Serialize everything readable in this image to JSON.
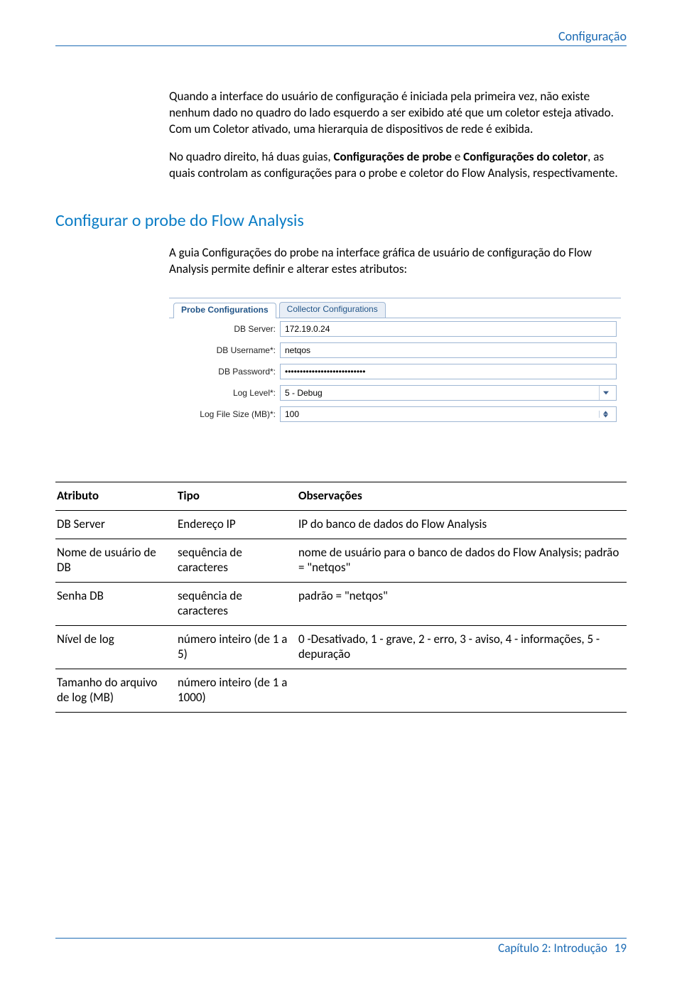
{
  "header": {
    "title": "Configuração"
  },
  "body": {
    "p1_a": "Quando a interface do usuário de configuração é iniciada pela primeira vez, não existe nenhum dado no quadro do lado esquerdo a ser exibido até que um coletor esteja ativado. Com um Coletor ativado, uma hierarquia de dispositivos de rede é exibida.",
    "p2_prefix": "No quadro direito, há duas guias, ",
    "p2_bold1": "Configurações de probe",
    "p2_middle": " e ",
    "p2_bold2": "Configurações do coletor",
    "p2_suffix": ", as quais controlam as configurações para o probe e coletor do Flow Analysis, respectivamente."
  },
  "section": {
    "title": "Configurar o probe do Flow Analysis",
    "intro": "A guia Configurações do probe na interface gráfica de usuário de configuração do Flow Analysis permite definir e alterar estes atributos:"
  },
  "shot": {
    "tab_probe": "Probe Configurations",
    "tab_collector": "Collector Configurations",
    "labels": {
      "db_server": "DB Server:",
      "db_user": "DB Username*:",
      "db_pass": "DB Password*:",
      "log_level": "Log Level*:",
      "log_size": "Log File Size (MB)*:"
    },
    "values": {
      "db_server": "172.19.0.24",
      "db_user": "netqos",
      "db_pass": "•••••••••••••••••••••••••••",
      "log_level": "5 - Debug",
      "log_size": "100"
    }
  },
  "table": {
    "headers": {
      "attr": "Atributo",
      "tipo": "Tipo",
      "obs": "Observações"
    },
    "rows": [
      {
        "attr": "DB Server",
        "tipo": "Endereço IP",
        "obs": "IP do banco de dados do Flow Analysis"
      },
      {
        "attr": "Nome de usuário de DB",
        "tipo": "sequência de caracteres",
        "obs": "nome de usuário para o banco de dados do Flow Analysis; padrão = \"netqos\""
      },
      {
        "attr": "Senha DB",
        "tipo": "sequência de caracteres",
        "obs": "padrão = \"netqos\""
      },
      {
        "attr": "Nível de log",
        "tipo": "número inteiro (de 1 a 5)",
        "obs": "0 -Desativado, 1 - grave, 2 - erro, 3 - aviso, 4 - informações, 5 - depuração"
      },
      {
        "attr": "Tamanho do arquivo de log (MB)",
        "tipo": "número inteiro (de 1 a 1000)",
        "obs": ""
      }
    ]
  },
  "footer": {
    "chapter": "Capítulo 2: Introdução",
    "page": "19"
  }
}
